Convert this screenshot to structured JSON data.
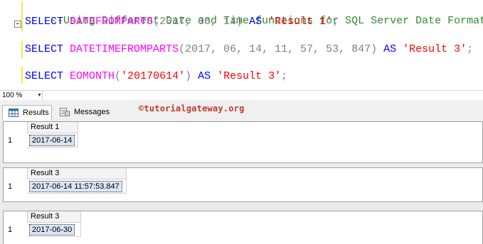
{
  "editor": {
    "comment": "--Using Different Date and Time functions for SQL Server Date Format",
    "line1": {
      "kw_select": "SELECT",
      "fn": "DATEFROMPARTS",
      "args": "(2017, 06, 14)",
      "kw_as": "AS",
      "alias": "'Result 1'",
      "semi": ";"
    },
    "line2": {
      "kw_select": "SELECT",
      "fn": "DATETIMEFROMPARTS",
      "args": "(2017, 06, 14, 11, 57, 53, 847)",
      "kw_as": "AS",
      "alias": "'Result 3'",
      "semi": ";"
    },
    "line3": {
      "kw_select": "SELECT",
      "fn": "EOMONTH",
      "open": "(",
      "arg": "'20170614'",
      "close": ")",
      "kw_as": "AS",
      "alias": "'Result 3'",
      "semi": ";"
    }
  },
  "zoom": {
    "value": "100 %"
  },
  "tabs": {
    "results": "Results",
    "messages": "Messages"
  },
  "watermark": "©tutorialgateway.org",
  "grids": [
    {
      "header": "Result 1",
      "row_number": "1",
      "value": "2017-06-14"
    },
    {
      "header": "Result 3",
      "row_number": "1",
      "value": "2017-06-14 11:57:53.847"
    },
    {
      "header": "Result 3",
      "row_number": "1",
      "value": "2017-06-30"
    }
  ],
  "colors": {
    "comment": "#2e8b2e",
    "keyword": "#0000ff",
    "function": "#ff00ff",
    "string": "#ff0000",
    "watermark": "#c0392b",
    "selected_cell": "#dbe6f4"
  }
}
